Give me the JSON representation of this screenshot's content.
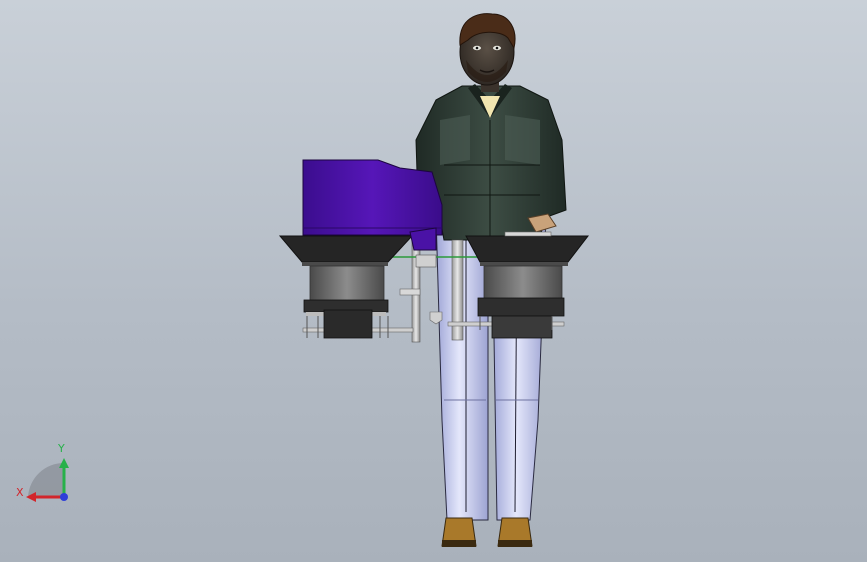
{
  "viewport": {
    "background_top": "#c9d0d8",
    "background_bottom": "#a9b1bb"
  },
  "triad": {
    "x_label": "X",
    "y_label": "Y",
    "x_color": "#d2252b",
    "y_color": "#27b14a",
    "z_color": "#2f3fd8"
  },
  "model": {
    "housing_color": "#4a12a6",
    "bowl_color": "#252525",
    "shirt_color": "#2c3a33",
    "pants_color": "#b9bfe4",
    "shoe_color": "#a9792a"
  }
}
